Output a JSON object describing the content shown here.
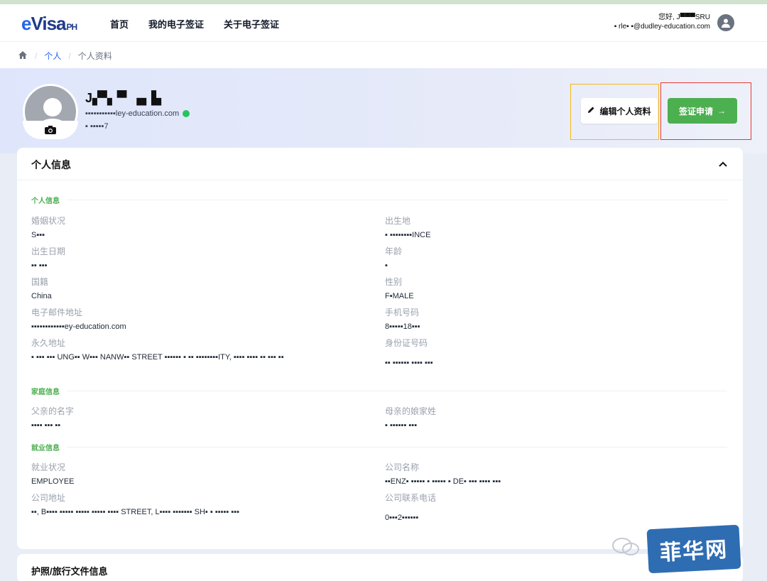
{
  "brand": {
    "e": "e",
    "visa": "Visa",
    "ph": "PH"
  },
  "nav": {
    "items": [
      "首页",
      "我的电子签证",
      "关于电子签证"
    ]
  },
  "user": {
    "greeting": "您好, J▀▀▀SRU",
    "email": "▪ rle▪ ▪@dudley-education.com"
  },
  "breadcrumb": {
    "items": [
      "个人",
      "个人资料"
    ]
  },
  "profile": {
    "name": "J▞▚▝▘▗▖▙",
    "email": "▪▪▪▪▪▪▪▪▪▪▪ley-education.com",
    "id": "▪ ▪▪▪▪▪7"
  },
  "actions": {
    "edit_label": "编辑个人资料",
    "apply_label": "签证申请"
  },
  "card": {
    "title": "个人信息"
  },
  "sections": {
    "personal": "个人信息",
    "family": "家庭信息",
    "employment": "就业信息"
  },
  "fields": {
    "marital": {
      "label": "婚姻状况",
      "value": "S▪▪▪"
    },
    "birthplace": {
      "label": "出生地",
      "value": "▪ ▪▪▪▪▪▪▪▪INCE"
    },
    "dob": {
      "label": "出生日期",
      "value": "▪▪ ▪▪▪"
    },
    "age": {
      "label": "年龄",
      "value": "▪"
    },
    "nationality": {
      "label": "国籍",
      "value": "China"
    },
    "gender": {
      "label": "性别",
      "value": "F▪MALE"
    },
    "email": {
      "label": "电子邮件地址",
      "value": "▪▪▪▪▪▪▪▪▪▪▪▪ey-education.com"
    },
    "phone": {
      "label": "手机号码",
      "value": "8▪▪▪▪▪18▪▪▪"
    },
    "address": {
      "label": "永久地址",
      "value": "▪ ▪▪▪ ▪▪▪ UNG▪▪ W▪▪▪ NANW▪▪ STREET ▪▪▪▪▪▪ ▪ ▪▪ ▪▪▪▪▪▪▪▪ITY, ▪▪▪▪ ▪▪▪▪ ▪▪ ▪▪▪ ▪▪"
    },
    "idnum": {
      "label": "身份证号码",
      "value": "▪▪ ▪▪▪▪▪▪ ▪▪▪▪ ▪▪▪"
    },
    "father": {
      "label": "父亲的名字",
      "value": "▪▪▪▪ ▪▪▪ ▪▪"
    },
    "mother": {
      "label": "母亲的娘家姓",
      "value": "▪ ▪▪▪▪▪▪ ▪▪▪"
    },
    "employment": {
      "label": "就业状况",
      "value": "EMPLOYEE"
    },
    "company": {
      "label": "公司名称",
      "value": "▪▪ENZ▪ ▪▪▪▪▪ ▪ ▪▪▪▪▪ ▪ DE▪ ▪▪▪ ▪▪▪▪ ▪▪▪"
    },
    "company_addr": {
      "label": "公司地址",
      "value": "▪▪, B▪▪▪▪ ▪▪▪▪▪ ▪▪▪▪▪ ▪▪▪▪▪ ▪▪▪▪ STREET, L▪▪▪▪ ▪▪▪▪▪▪▪ SH▪ ▪ ▪▪▪▪▪ ▪▪▪"
    },
    "company_phone": {
      "label": "公司联系电话",
      "value": "0▪▪▪2▪▪▪▪▪▪"
    }
  },
  "card2": {
    "title": "护照/旅行文件信息"
  },
  "watermark": {
    "text": "菲华网"
  }
}
